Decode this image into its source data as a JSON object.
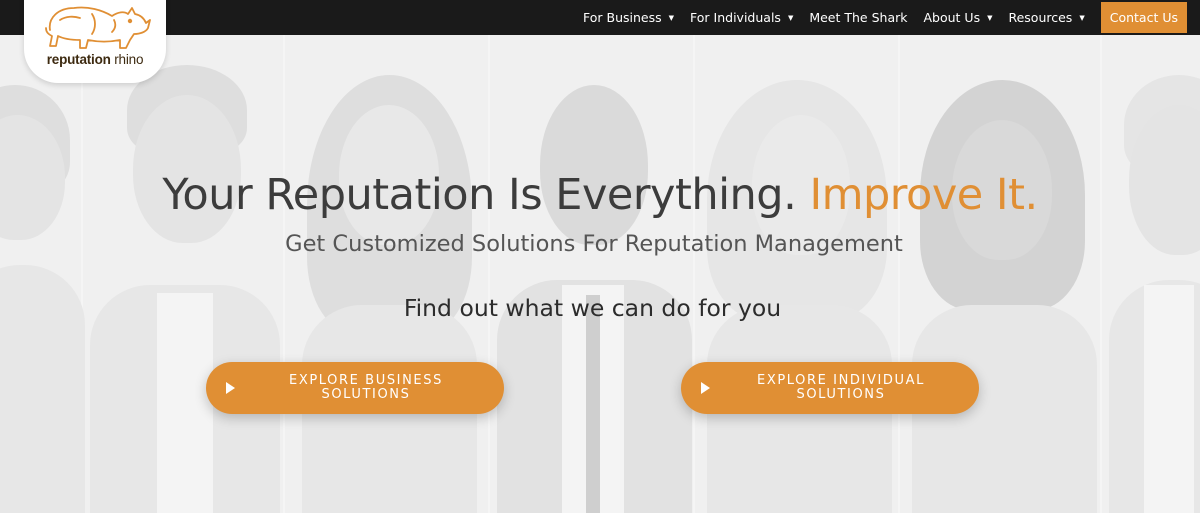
{
  "brand": {
    "name_bold": "reputation",
    "name_regular": "rhino",
    "accent_color": "#e08f34",
    "nav_bg_color": "#1a1a1a"
  },
  "nav": {
    "items": [
      {
        "label": "For Business",
        "has_dropdown": true
      },
      {
        "label": "For Individuals",
        "has_dropdown": true
      },
      {
        "label": "Meet The Shark",
        "has_dropdown": false
      },
      {
        "label": "About Us",
        "has_dropdown": true
      },
      {
        "label": "Resources",
        "has_dropdown": true
      }
    ],
    "contact_label": "Contact Us",
    "caret_icon": "caret-down-icon"
  },
  "hero": {
    "headline_main": "Your Reputation Is Everything.",
    "headline_accent": "Improve It.",
    "subheadline": "Get Customized Solutions For Reputation Management",
    "cta_text": "Find out what we can do for you",
    "buttons": [
      {
        "line1": "EXPLORE BUSINESS",
        "line2": "SOLUTIONS",
        "icon": "play-icon"
      },
      {
        "line1": "EXPLORE INDIVIDUAL",
        "line2": "SOLUTIONS",
        "icon": "play-icon"
      }
    ]
  }
}
